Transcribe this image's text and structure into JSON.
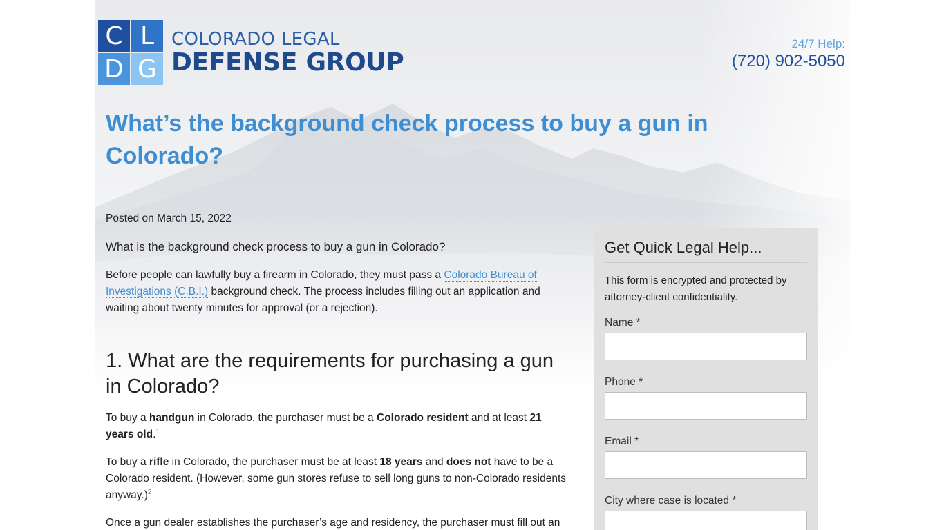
{
  "header": {
    "logo_letters": [
      "C",
      "L",
      "D",
      "G"
    ],
    "logo_line1": "COLORADO LEGAL",
    "logo_line2": "DEFENSE GROUP",
    "help_label": "24/7 Help:",
    "help_phone": "(720) 902-5050"
  },
  "article": {
    "title": "What’s the background check process to buy a gun in Colorado?",
    "posted": "Posted on March 15, 2022",
    "lead": "What is the background check process to buy a gun in Colorado?",
    "p1_before": "Before people can lawfully buy a firearm in Colorado, they must pass a ",
    "p1_link": "Colorado Bureau of Investigations (C.B.I.)",
    "p1_after": " background check. The process includes filling out an application and waiting about twenty minutes for approval (or a rejection).",
    "h2_1": "1. What are the requirements for purchasing a gun in Colorado?",
    "p2": {
      "a": "To buy a ",
      "b": "handgun",
      "c": " in Colorado, the purchaser must be a ",
      "d": "Colorado resident",
      "e": " and at least ",
      "f": "21 years old",
      "g": ".",
      "sup": "1"
    },
    "p3": {
      "a": "To buy a ",
      "b": "rifle",
      "c": " in Colorado, the purchaser must be at least ",
      "d": "18 years",
      "e": " and ",
      "f": "does not",
      "g": " have to be a Colorado resident. (However, some gun stores refuse to sell long guns to non-Colorado residents anyway.)",
      "sup": "2"
    },
    "p4": "Once a gun dealer establishes the purchaser’s age and residency, the purchaser must fill out an"
  },
  "sidebar": {
    "title": "Get Quick Legal Help...",
    "description": "This form is encrypted and protected by attorney-client confidentiality.",
    "fields": [
      {
        "label": "Name *"
      },
      {
        "label": "Phone *"
      },
      {
        "label": "Email *"
      },
      {
        "label": "City where case is located *"
      }
    ]
  },
  "colors": {
    "brand_dark": "#1f4f9e",
    "brand_light": "#3f8ed1",
    "sidebar_bg": "#e0e0e0"
  }
}
